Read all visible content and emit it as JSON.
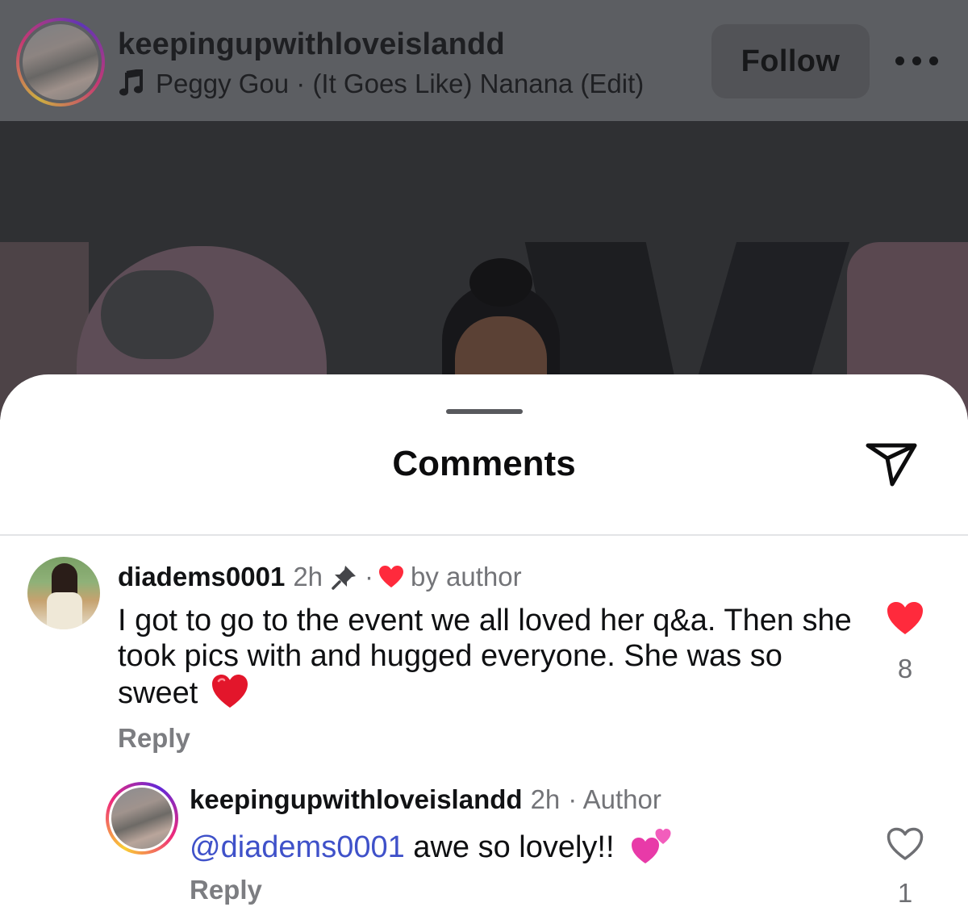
{
  "post": {
    "username": "keepingupwithloveislandd",
    "music": "Peggy Gou · (It Goes Like) Nanana (Edit)",
    "follow_label": "Follow"
  },
  "sheet": {
    "title": "Comments"
  },
  "comments": [
    {
      "username": "diadems0001",
      "time": "2h",
      "separator": "·",
      "liked_by": "by author",
      "text": "I got to go to the event we all loved her q&a. Then she took pics with and hugged everyone. She was so sweet",
      "reply_label": "Reply",
      "likes": "8",
      "liked": true
    },
    {
      "username": "keepingupwithloveislandd",
      "time": "2h",
      "author_label": "· Author",
      "mention": "@diadems0001",
      "text": " awe so lovely!!",
      "reply_label": "Reply",
      "likes": "1",
      "liked": false
    }
  ],
  "colors": {
    "like_red": "#ff3040",
    "mention_blue": "#3f51c9",
    "ring_gradient": [
      "#f9ce34",
      "#ee2a7b",
      "#6228d7"
    ]
  },
  "icons": [
    "music-note-icon",
    "more-options-icon",
    "share-icon",
    "pin-icon",
    "heart-icon",
    "heart-outline-icon",
    "red-heart-emoji",
    "two-hearts-emoji"
  ]
}
